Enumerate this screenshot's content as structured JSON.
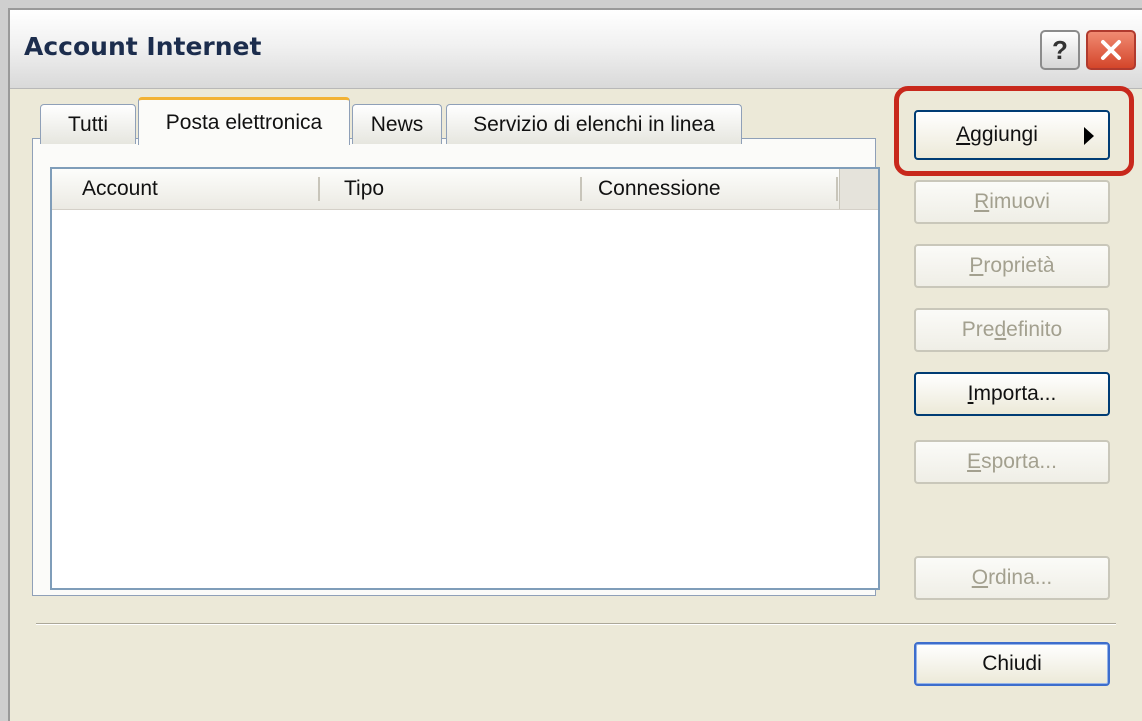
{
  "window": {
    "title": "Account Internet"
  },
  "titlebar": {
    "help_label": "?"
  },
  "tabs": [
    {
      "label": "Tutti"
    },
    {
      "label": "Posta elettronica"
    },
    {
      "label": "News"
    },
    {
      "label": "Servizio di elenchi in linea"
    }
  ],
  "list": {
    "columns": [
      "Account",
      "Tipo",
      "Connessione"
    ],
    "rows": []
  },
  "buttons": {
    "add": {
      "label": "Aggiungi",
      "mnemonic": "A",
      "rest": "ggiungi"
    },
    "remove": {
      "label": "Rimuovi",
      "mnemonic": "R",
      "rest": "imuovi"
    },
    "properties": {
      "label": "Proprietà",
      "mnemonic": "P",
      "rest": "roprietà"
    },
    "default": {
      "label": "Predefinito",
      "pre": "Pre",
      "mnemonic": "d",
      "rest": "efinito"
    },
    "import": {
      "label": "Importa...",
      "mnemonic": "I",
      "rest": "mporta..."
    },
    "export": {
      "label": "Esporta...",
      "mnemonic": "E",
      "rest": "sporta..."
    },
    "order": {
      "label": "Ordina...",
      "mnemonic": "O",
      "rest": "rdina..."
    },
    "close": {
      "label": "Chiudi"
    }
  },
  "colors": {
    "highlight": "#c8281c",
    "tab_accent": "#f2b234"
  }
}
